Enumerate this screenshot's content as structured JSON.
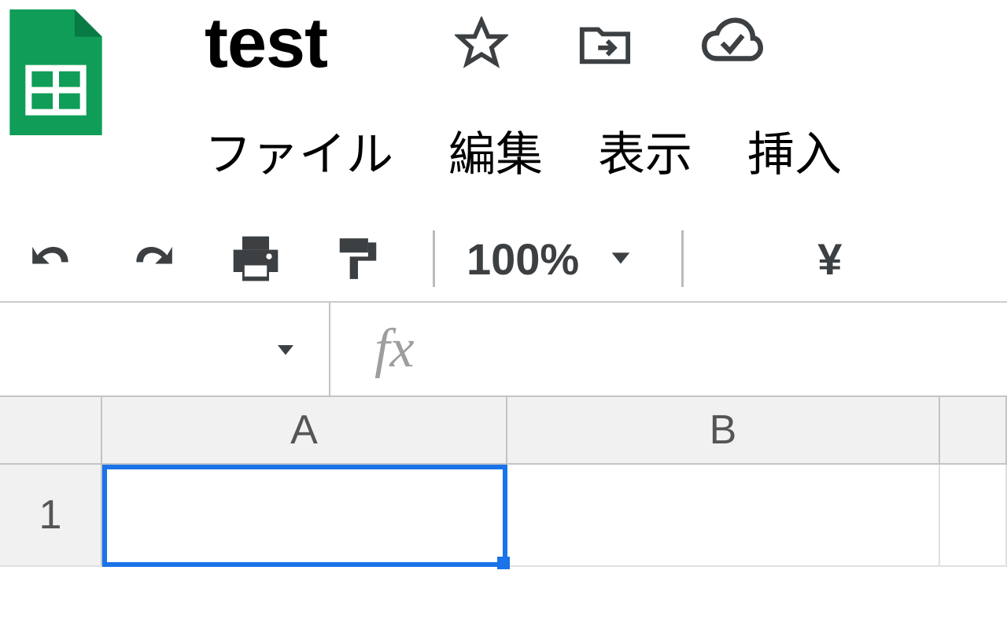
{
  "header": {
    "title": "test",
    "icons": {
      "star": "star-icon",
      "move": "move-folder-icon",
      "cloud": "cloud-check-icon"
    }
  },
  "menu": {
    "file": "ファイル",
    "edit": "編集",
    "view": "表示",
    "insert": "挿入"
  },
  "toolbar": {
    "zoom": "100%",
    "currency": "¥"
  },
  "formula_bar": {
    "fx_label": "fx",
    "value": ""
  },
  "grid": {
    "columns": [
      "A",
      "B"
    ],
    "rows": [
      "1"
    ],
    "selected_cell": "A1"
  },
  "colors": {
    "accent": "#1a73e8",
    "logo_green": "#0f9d58",
    "icon_dark": "#3c4043"
  }
}
